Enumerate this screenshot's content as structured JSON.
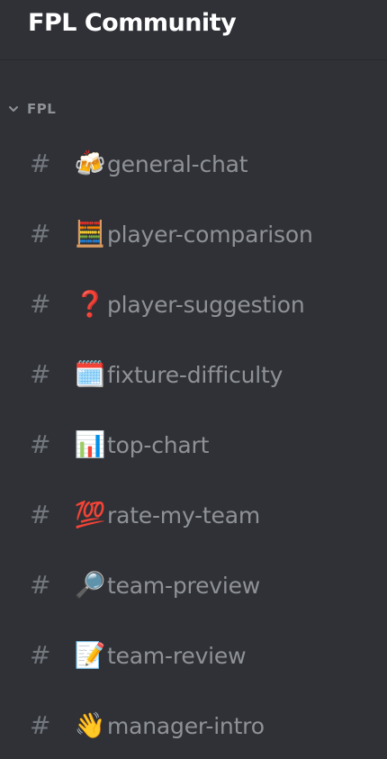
{
  "server": {
    "name": "FPL Community"
  },
  "category": {
    "label": "FPL",
    "icon": "chevron-down-icon"
  },
  "channels": [
    {
      "hash": "#",
      "emoji": "🍻",
      "emoji_name": "beer-mugs-icon",
      "name": "general-chat"
    },
    {
      "hash": "#",
      "emoji": "🧮",
      "emoji_name": "abacus-icon",
      "name": "player-comparison"
    },
    {
      "hash": "#",
      "emoji": "❓",
      "emoji_name": "question-mark-icon",
      "name": "player-suggestion"
    },
    {
      "hash": "#",
      "emoji": "🗓️",
      "emoji_name": "calendar-icon",
      "name": "fixture-difficulty"
    },
    {
      "hash": "#",
      "emoji": "📊",
      "emoji_name": "bar-chart-icon",
      "name": "top-chart"
    },
    {
      "hash": "#",
      "emoji": "💯",
      "emoji_name": "hundred-points-icon",
      "name": "rate-my-team"
    },
    {
      "hash": "#",
      "emoji": "🔎",
      "emoji_name": "magnifying-glass-icon",
      "name": "team-preview"
    },
    {
      "hash": "#",
      "emoji": "📝",
      "emoji_name": "memo-icon",
      "name": "team-review"
    },
    {
      "hash": "#",
      "emoji": "👋",
      "emoji_name": "waving-hand-icon",
      "name": "manager-intro"
    }
  ],
  "colors": {
    "background": "#2f3136",
    "header_text": "#ffffff",
    "channel_text": "#8e9297",
    "hash_icon": "#72767d"
  }
}
